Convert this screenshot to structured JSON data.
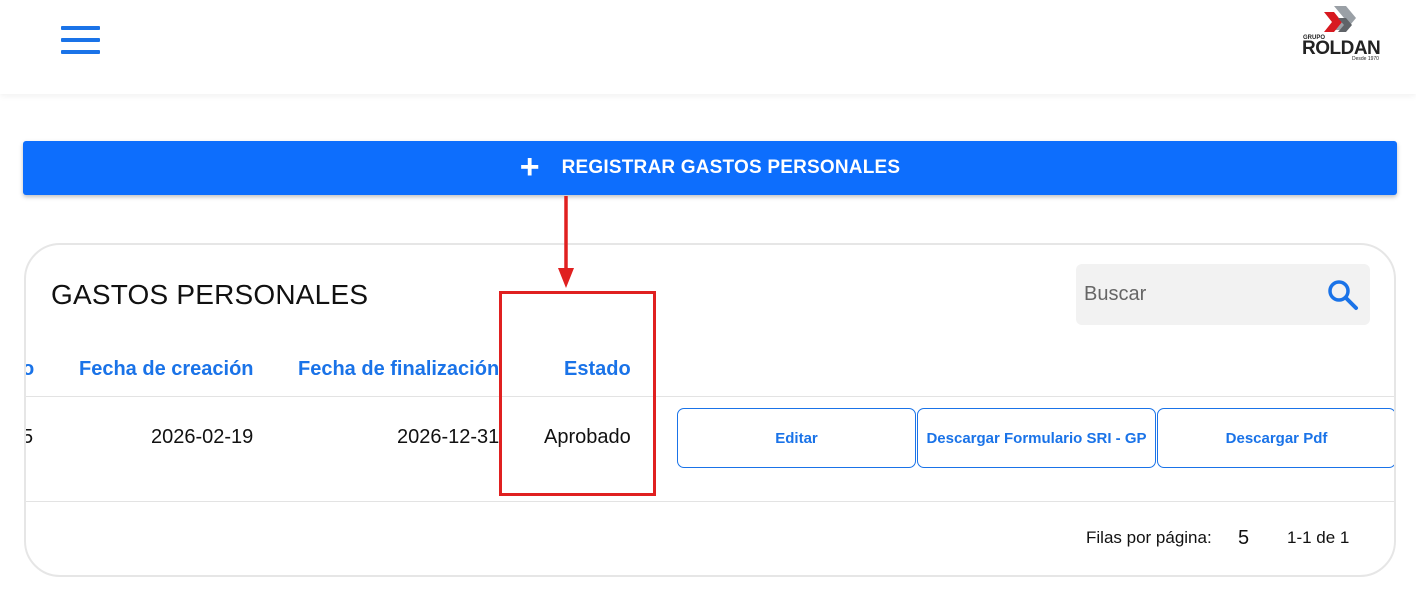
{
  "header": {
    "menu_icon": "hamburger-menu-icon",
    "logo": {
      "small_text": "GRUPO",
      "main_text": "ROLDAN",
      "since_text": "Desde 1970"
    }
  },
  "register_button": {
    "icon": "plus-icon",
    "label": "REGISTRAR GASTOS PERSONALES",
    "color": "#0d6efd"
  },
  "card": {
    "title": "GASTOS PERSONALES",
    "search": {
      "placeholder": "Buscar",
      "value": "",
      "icon": "search-icon"
    },
    "table": {
      "partial_header_fragment": "o",
      "columns": [
        "Fecha de creación",
        "Fecha de finalización",
        "Estado"
      ],
      "rows": [
        {
          "partial_cell_fragment": "5",
          "fecha_creacion": "2026-02-19",
          "fecha_finalizacion": "2026-12-31",
          "estado": "Aprobado",
          "actions": [
            "Editar",
            "Descargar Formulario SRI - GP",
            "Descargar Pdf"
          ]
        }
      ]
    },
    "pagination": {
      "rows_per_page_label": "Filas por página:",
      "rows_per_page_value": "5",
      "range_text": "1-1 de 1"
    }
  },
  "annotation": {
    "color": "#e02020",
    "highlighted_column": "Estado"
  }
}
